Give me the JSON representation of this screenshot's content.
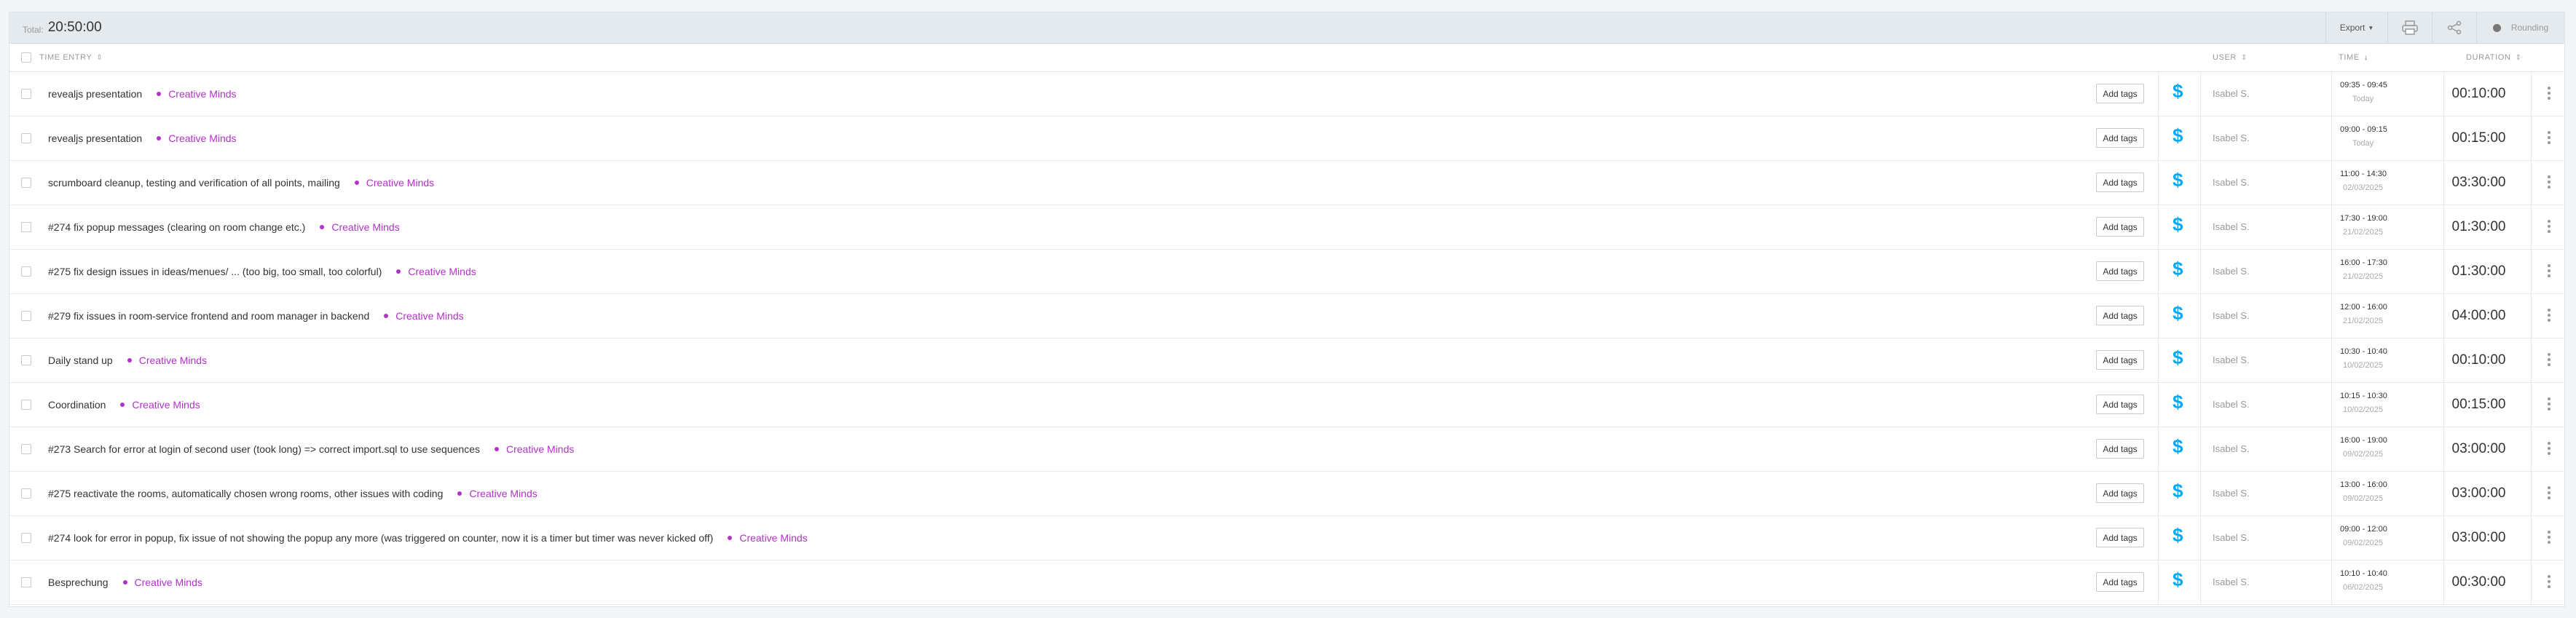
{
  "summary": {
    "total_label": "Total:",
    "total_value": "20:50:00",
    "export_label": "Export",
    "rounding_label": "Rounding"
  },
  "header": {
    "time_entry": "TIME ENTRY",
    "user": "USER",
    "time": "TIME",
    "duration": "DURATION"
  },
  "add_tags_label": "Add tags",
  "billable_symbol": "$",
  "colors": {
    "project": "#b132c7",
    "billable": "#03a9f4",
    "summary_bg": "#e4eaee"
  },
  "entries": [
    {
      "description": "revealjs presentation",
      "project": "Creative Minds",
      "user": "Isabel S.",
      "time_range": "09:35 - 09:45",
      "date": "Today",
      "duration": "00:10:00"
    },
    {
      "description": "revealjs presentation",
      "project": "Creative Minds",
      "user": "Isabel S.",
      "time_range": "09:00 - 09:15",
      "date": "Today",
      "duration": "00:15:00"
    },
    {
      "description": "scrumboard cleanup, testing and verification of all points, mailing",
      "project": "Creative Minds",
      "user": "Isabel S.",
      "time_range": "11:00 - 14:30",
      "date": "02/03/2025",
      "duration": "03:30:00"
    },
    {
      "description": "#274 fix popup messages (clearing on room change etc.)",
      "project": "Creative Minds",
      "user": "Isabel S.",
      "time_range": "17:30 - 19:00",
      "date": "21/02/2025",
      "duration": "01:30:00"
    },
    {
      "description": "#275 fix design issues in ideas/menues/ ... (too big, too small, too colorful)",
      "project": "Creative Minds",
      "user": "Isabel S.",
      "time_range": "16:00 - 17:30",
      "date": "21/02/2025",
      "duration": "01:30:00"
    },
    {
      "description": "#279 fix issues in room-service frontend and room manager in backend",
      "project": "Creative Minds",
      "user": "Isabel S.",
      "time_range": "12:00 - 16:00",
      "date": "21/02/2025",
      "duration": "04:00:00"
    },
    {
      "description": "Daily stand up",
      "project": "Creative Minds",
      "user": "Isabel S.",
      "time_range": "10:30 - 10:40",
      "date": "10/02/2025",
      "duration": "00:10:00"
    },
    {
      "description": "Coordination",
      "project": "Creative Minds",
      "user": "Isabel S.",
      "time_range": "10:15 - 10:30",
      "date": "10/02/2025",
      "duration": "00:15:00"
    },
    {
      "description": "#273 Search for error at login of second user (took long) => correct import.sql to use sequences",
      "project": "Creative Minds",
      "user": "Isabel S.",
      "time_range": "16:00 - 19:00",
      "date": "09/02/2025",
      "duration": "03:00:00"
    },
    {
      "description": "#275 reactivate the rooms, automatically chosen wrong rooms, other issues with coding",
      "project": "Creative Minds",
      "user": "Isabel S.",
      "time_range": "13:00 - 16:00",
      "date": "09/02/2025",
      "duration": "03:00:00"
    },
    {
      "description": "#274 look for error in popup, fix issue of not showing the popup any more (was triggered on counter, now it is a timer but timer was never kicked off)",
      "project": "Creative Minds",
      "user": "Isabel S.",
      "time_range": "09:00 - 12:00",
      "date": "09/02/2025",
      "duration": "03:00:00"
    },
    {
      "description": "Besprechung",
      "project": "Creative Minds",
      "user": "Isabel S.",
      "time_range": "10:10 - 10:40",
      "date": "06/02/2025",
      "duration": "00:30:00"
    }
  ]
}
